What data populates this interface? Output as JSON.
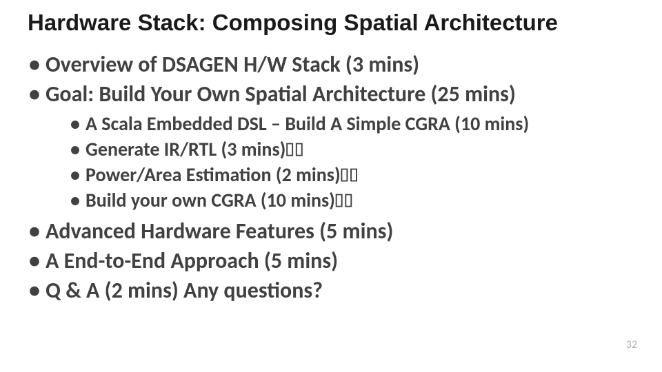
{
  "title": "Hardware Stack: Composing Spatial Architecture",
  "bullets": {
    "b1": "Overview of DSAGEN H/W Stack (3 mins)",
    "b2": "Goal: Build Your Own Spatial Architecture (25 mins)",
    "b2_1": "A Scala Embedded DSL – Build A Simple CGRA (10 mins)",
    "b2_2": "Generate IR/RTL (3 mins)",
    "b2_3": "Power/Area Estimation (2 mins)",
    "b2_4": "Build your own CGRA (10 mins)",
    "b3": "Advanced Hardware Features (5 mins)",
    "b4": "A End-to-End Approach (5 mins)",
    "b5": "Q & A (2 mins) Any questions?"
  },
  "glyph_pair": "⌷⌷",
  "page_number": "32"
}
